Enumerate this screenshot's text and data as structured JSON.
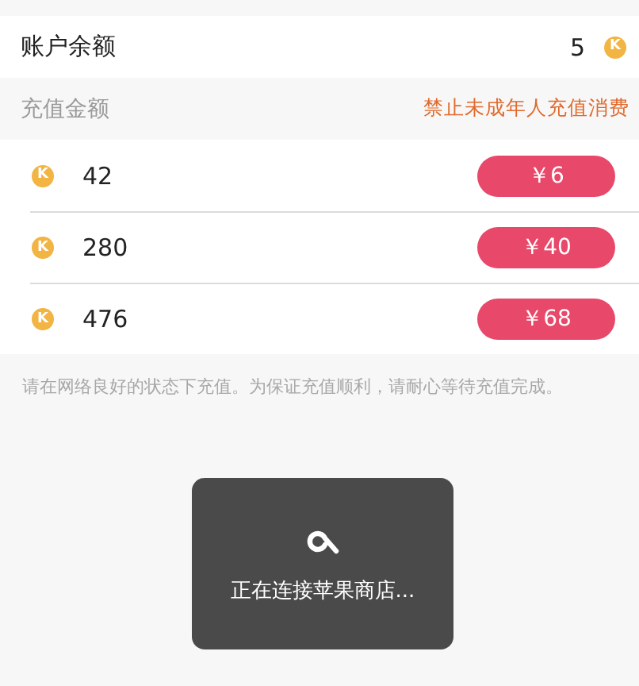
{
  "balance": {
    "label": "账户余额",
    "value": "5",
    "coin_symbol": "K"
  },
  "recharge_header": {
    "label": "充值金额",
    "warning": "禁止未成年人充值消费"
  },
  "options": [
    {
      "coins": "42",
      "coin_symbol": "K",
      "price": "￥6"
    },
    {
      "coins": "280",
      "coin_symbol": "K",
      "price": "￥40"
    },
    {
      "coins": "476",
      "coin_symbol": "K",
      "price": "￥68"
    }
  ],
  "note": "请在网络良好的状态下充值。为保证充值顺利，请耐心等待充值完成。",
  "toast": {
    "message": "正在连接苹果商店..."
  }
}
